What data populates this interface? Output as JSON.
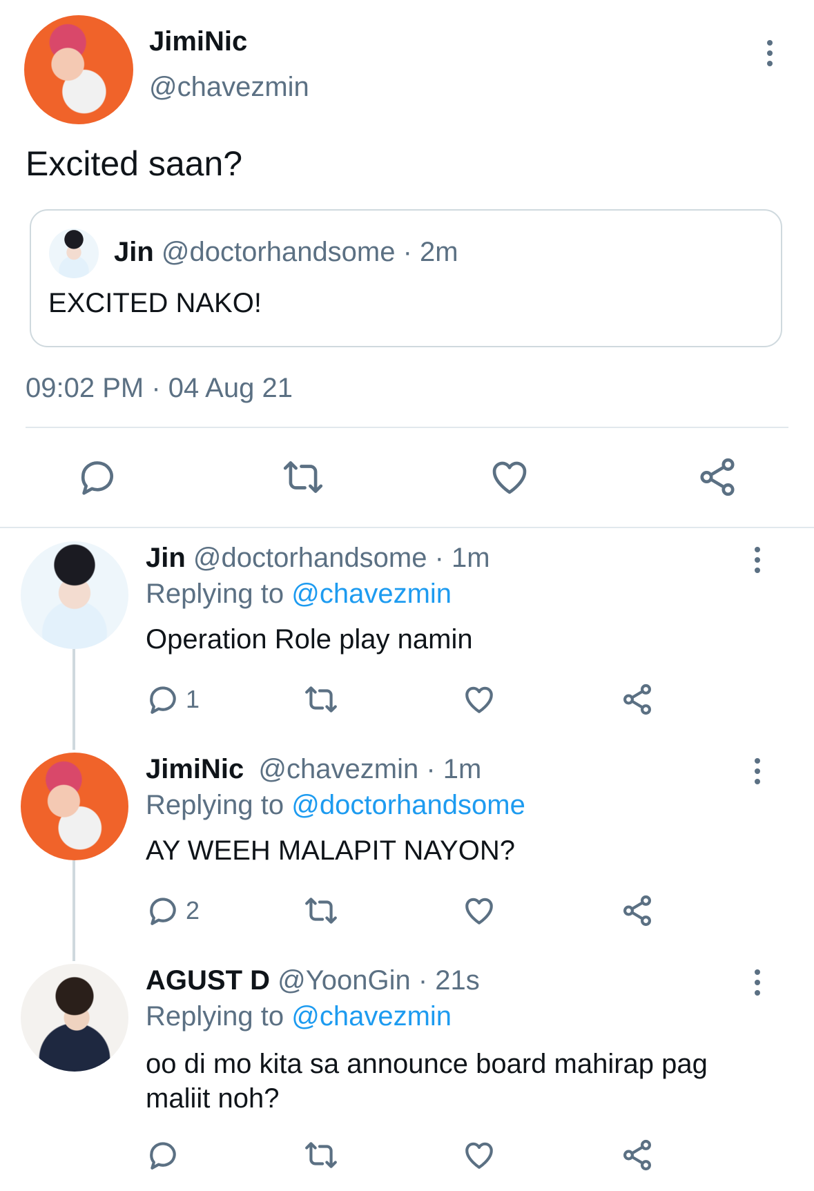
{
  "main_tweet": {
    "display_name": "JimiNic",
    "handle": "@chavezmin",
    "text": "Excited saan?",
    "quoted": {
      "display_name": "Jin",
      "handle": "@doctorhandsome",
      "time": "· 2m",
      "text": "EXCITED NAKO!"
    },
    "timestamp": "09:02 PM · 04 Aug 21"
  },
  "replies": [
    {
      "display_name": "Jin",
      "handle": "@doctorhandsome",
      "time": "· 1m",
      "replying_prefix": "Replying to",
      "replying_to": "@chavezmin",
      "text": "Operation Role play namin",
      "reply_count": "1"
    },
    {
      "display_name": "JimiNic",
      "handle": "@chavezmin",
      "time": "· 1m",
      "replying_prefix": "Replying to",
      "replying_to": "@doctorhandsome",
      "text": "AY WEEH MALAPIT NAYON?",
      "reply_count": "2"
    },
    {
      "display_name": "AGUST D",
      "handle": "@YoonGin",
      "time": "· 21s",
      "replying_prefix": "Replying to",
      "replying_to": "@chavezmin",
      "text": "oo di mo kita sa announce board mahirap pag maliit noh?",
      "reply_count": ""
    }
  ],
  "icons": {
    "reply": "reply-icon",
    "retweet": "retweet-icon",
    "like": "heart-icon",
    "share": "share-icon",
    "more": "more-vertical-icon"
  },
  "colors": {
    "link": "#1d9bf0",
    "secondary_text": "#5b7083",
    "divider": "#cfd9de"
  }
}
